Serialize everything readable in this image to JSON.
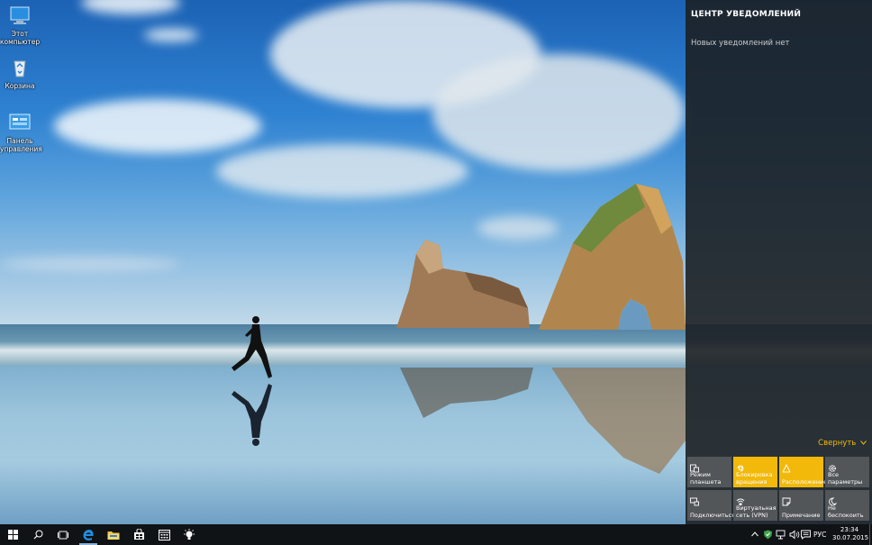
{
  "desktop": {
    "icons": [
      {
        "label": "Этот компьютер",
        "icon": "computer-icon"
      },
      {
        "label": "Корзина",
        "icon": "recycle-bin-icon"
      },
      {
        "label": "Панель управления",
        "icon": "control-panel-icon"
      }
    ]
  },
  "action_center": {
    "title": "ЦЕНТР УВЕДОМЛЕНИЙ",
    "empty_text": "Новых уведомлений нет",
    "collapse_label": "Свернуть",
    "tiles": [
      {
        "label": "Режим планшета",
        "icon": "tablet-mode-icon",
        "active": false
      },
      {
        "label": "Блокировка вращения",
        "icon": "rotation-lock-icon",
        "active": true
      },
      {
        "label": "Расположение",
        "icon": "location-icon",
        "active": true
      },
      {
        "label": "Все параметры",
        "icon": "settings-icon",
        "active": false
      },
      {
        "label": "Подключиться",
        "icon": "connect-icon",
        "active": false
      },
      {
        "label": "Виртуальная сеть (VPN)",
        "icon": "vpn-icon",
        "active": false
      },
      {
        "label": "Примечание",
        "icon": "note-icon",
        "active": false
      },
      {
        "label": "Не беспокоить",
        "icon": "quiet-hours-icon",
        "active": false
      }
    ],
    "accent_color": "#f2b90b"
  },
  "taskbar": {
    "apps": [
      "start-icon",
      "search-icon",
      "task-view-icon",
      "edge-icon",
      "file-explorer-icon",
      "store-icon",
      "calendar-icon",
      "tips-icon"
    ],
    "language": "РУС",
    "time": "23:34",
    "date": "30.07.2015"
  }
}
